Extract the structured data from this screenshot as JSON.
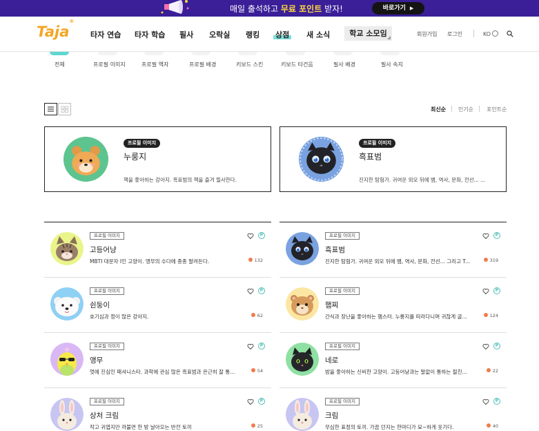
{
  "banner": {
    "text_prefix": "매일 출석하고 ",
    "text_highlight": "무료 포인트",
    "text_suffix": " 받자!",
    "button_label": "바로가기",
    "button_arrow": "▶"
  },
  "nav": {
    "logo": "Taja",
    "logo_mark": "®",
    "items": [
      "타자 연습",
      "타자 학습",
      "필사",
      "오락실",
      "랭킹",
      "상점",
      "새 소식"
    ],
    "active": "상점",
    "school_label": "학교 소모임",
    "signup": "회원가입",
    "login": "로그인",
    "language": "KO"
  },
  "categories": [
    "전체",
    "프로필 이미지",
    "프로필 액자",
    "프로필 배경",
    "키보드 스킨",
    "키보드 타건음",
    "필사 배경",
    "필사 속지"
  ],
  "sort_options": [
    "최신순",
    "인기순",
    "포인트순"
  ],
  "sort_active": "최신순",
  "featured": [
    {
      "badge": "프로필 이미지",
      "name": "누룽지",
      "desc": "책을 좋아하는 강아지. 흑표범의 책을 즐겨 필사한다.",
      "avatar": "puppy-orange-avatar",
      "bg": "#5dc48f"
    },
    {
      "badge": "프로필 이미지",
      "name": "흑표범",
      "desc": "진지한 탐험가. 귀여운 외모 뒤에 뱀, 역사, 문화, 전선... ...",
      "avatar": "black-panther-avatar",
      "bg": "#7aa2e0"
    }
  ],
  "items_left": [
    {
      "badge": "프로필 이미지",
      "name": "고등어냥",
      "desc": "MBTI 대문자 I인 고양이. 앵무의 수다에 종종 말려든다.",
      "comments": "132",
      "avatar": "tabby-cat-avatar",
      "bg": "#e9f58a"
    },
    {
      "badge": "프로필 이미지",
      "name": "쉰둥이",
      "desc": "호기심과 정이 많은 강아지.",
      "comments": "62",
      "avatar": "white-dog-avatar",
      "bg": "#8fd0f5"
    },
    {
      "badge": "프로필 이미지",
      "name": "앵무",
      "desc": "멋에 진심인 패셔니스타. 과학에 관심 많은 흑표범과 은근히 잘 통...",
      "comments": "54",
      "avatar": "parrot-avatar",
      "bg": "#d9b8f5"
    },
    {
      "badge": "프로필 이미지",
      "name": "상처 크림",
      "desc": "작고 귀엽지만 까불면 한 방 날아오는 반전 토끼",
      "comments": "25",
      "avatar": "bunny-avatar",
      "bg": "#c7c5f2"
    }
  ],
  "items_right": [
    {
      "badge": "프로필 이미지",
      "name": "흑표범",
      "desc": "진지한 탐험가. 귀여운 외모 뒤에 뱀, 역사, 문화, 전선... 그리고 T...",
      "comments": "319",
      "avatar": "black-panther-avatar",
      "bg": "#7aa2e0"
    },
    {
      "badge": "프로필 이미지",
      "name": "햄찌",
      "desc": "간식과 장난을 좋아하는 햄스터. 누룽지를 따라다니며 귀찮게 굴...",
      "comments": "124",
      "avatar": "hamster-avatar",
      "bg": "#fbe7a3"
    },
    {
      "badge": "프로필 이미지",
      "name": "네로",
      "desc": "밤을 좋아하는 신비한 고양이. 고등어냥과는 말없이 통하는 절친...",
      "comments": "22",
      "avatar": "black-cat-avatar",
      "bg": "#8fe0a3"
    },
    {
      "badge": "프로필 이미지",
      "name": "크림",
      "desc": "무심한 표정의 토끼. 가끔 던지는 한마디가 묘~하게 웃기다.",
      "comments": "40",
      "avatar": "bunny-avatar",
      "bg": "#c7c5f2"
    }
  ],
  "colors": {
    "banner_bg": "#3a1f98",
    "accent_teal": "#5fd6d0",
    "logo": "#f3a623",
    "comment_dot": "#f07c4b"
  }
}
